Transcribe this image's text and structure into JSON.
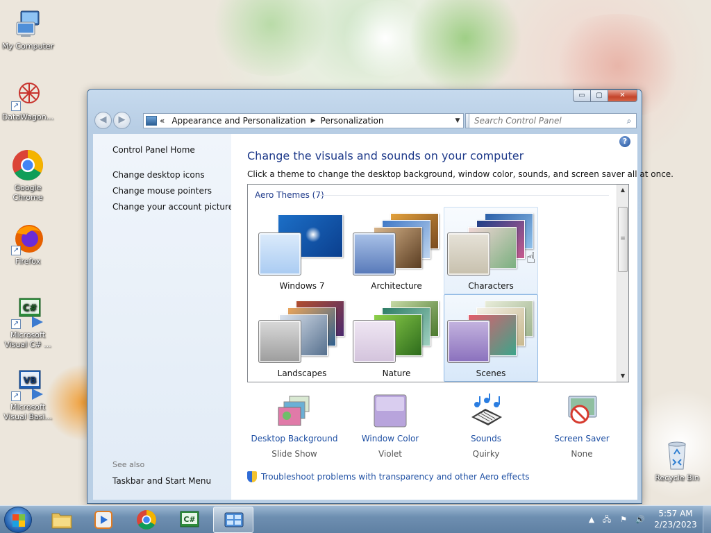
{
  "colors": {
    "accent": "#1e4fa3",
    "heading": "#1e3a8a",
    "window_frame": "#b9cfe5"
  },
  "desktop": {
    "icons": [
      {
        "label": "My Computer",
        "icon": "computer-icon"
      },
      {
        "label": "DataWagon...",
        "icon": "datawagon-icon"
      },
      {
        "label": "Google Chrome",
        "icon": "chrome-icon"
      },
      {
        "label": "Firefox",
        "icon": "firefox-icon"
      },
      {
        "label": "Microsoft Visual C# ...",
        "icon": "visual-csharp-icon"
      },
      {
        "label": "Microsoft Visual Basi...",
        "icon": "visual-basic-icon"
      },
      {
        "label": "Recycle Bin",
        "icon": "recycle-bin-icon"
      }
    ]
  },
  "window": {
    "controls": {
      "minimize": "▭",
      "maximize": "▢",
      "close": "✕"
    },
    "address": {
      "prefix": "«",
      "crumbs": [
        "Appearance and Personalization",
        "Personalization"
      ],
      "separator": "▶"
    },
    "search": {
      "placeholder": "Search Control Panel"
    },
    "left_pane": {
      "home": "Control Panel Home",
      "links": [
        "Change desktop icons",
        "Change mouse pointers",
        "Change your account picture"
      ],
      "see_also_label": "See also",
      "see_also_links": [
        "Taskbar and Start Menu"
      ]
    },
    "main": {
      "title": "Change the visuals and sounds on your computer",
      "subtitle": "Click a theme to change the desktop background, window color, sounds, and screen saver all at once.",
      "group_header": "Aero Themes (7)",
      "themes": [
        {
          "name": "Windows 7",
          "state": "normal"
        },
        {
          "name": "Architecture",
          "state": "normal"
        },
        {
          "name": "Characters",
          "state": "hover"
        },
        {
          "name": "Landscapes",
          "state": "normal"
        },
        {
          "name": "Nature",
          "state": "normal"
        },
        {
          "name": "Scenes",
          "state": "selected"
        }
      ],
      "settings": [
        {
          "label": "Desktop Background",
          "value": "Slide Show",
          "icon": "desktop-background-icon"
        },
        {
          "label": "Window Color",
          "value": "Violet",
          "icon": "window-color-icon"
        },
        {
          "label": "Sounds",
          "value": "Quirky",
          "icon": "sounds-icon"
        },
        {
          "label": "Screen Saver",
          "value": "None",
          "icon": "screen-saver-icon"
        }
      ],
      "troubleshoot_link": "Troubleshoot problems with transparency and other Aero effects"
    }
  },
  "taskbar": {
    "pinned": [
      "explorer-icon",
      "media-player-icon",
      "chrome-icon",
      "visual-csharp-icon",
      "control-panel-icon"
    ],
    "clock": {
      "time": "5:57 AM",
      "date": "2/23/2023"
    }
  }
}
